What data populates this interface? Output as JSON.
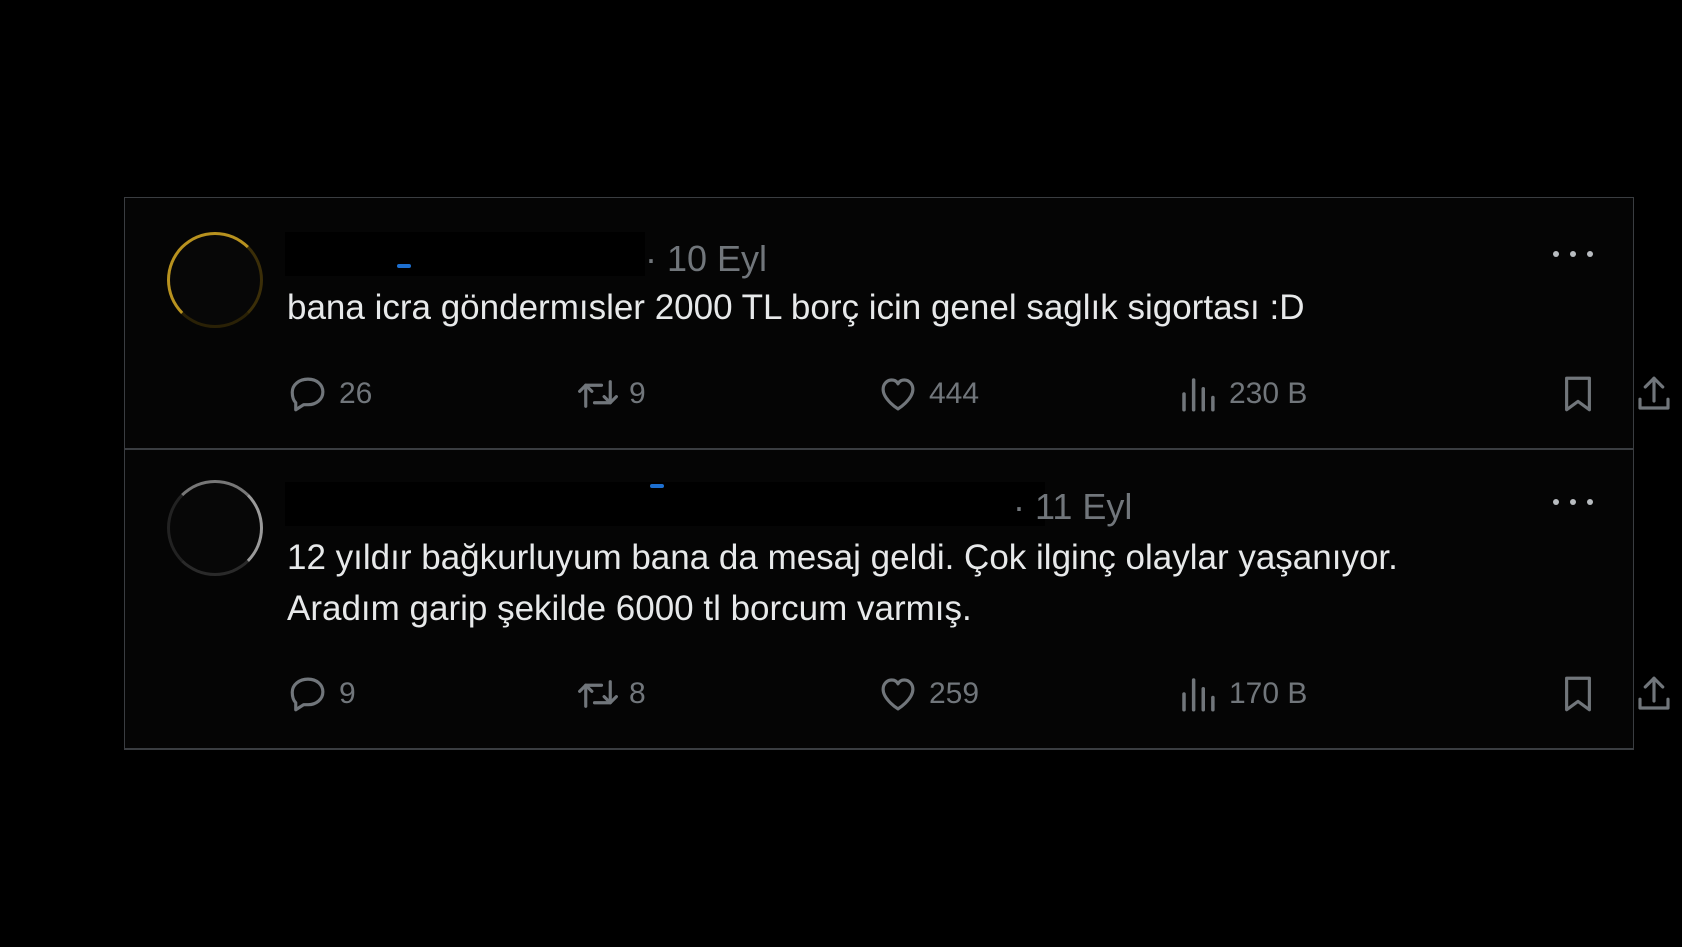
{
  "tweets": [
    {
      "meta": "· 10 Eyl",
      "text": "bana icra göndermısler 2000 TL borç icin genel saglık sigortası :D",
      "replies": "26",
      "retweets": "9",
      "likes": "444",
      "views": "230 B"
    },
    {
      "meta": "· 11 Eyl",
      "text": "12 yıldır bağkurluyum bana da mesaj geldi. Çok ilginç olaylar yaşanıyor. Aradım garip şekilde 6000 tl borcum varmış.",
      "replies": "9",
      "retweets": "8",
      "likes": "259",
      "views": "170 B"
    }
  ],
  "icons": {
    "reply": "reply-icon",
    "retweet": "retweet-icon",
    "like": "heart-icon",
    "views": "views-icon",
    "bookmark": "bookmark-icon",
    "share": "share-icon",
    "more": "more-icon"
  },
  "colors": {
    "background": "#000000",
    "text": "#e7e9ea",
    "muted": "#71767b",
    "border": "#3a3d41"
  }
}
